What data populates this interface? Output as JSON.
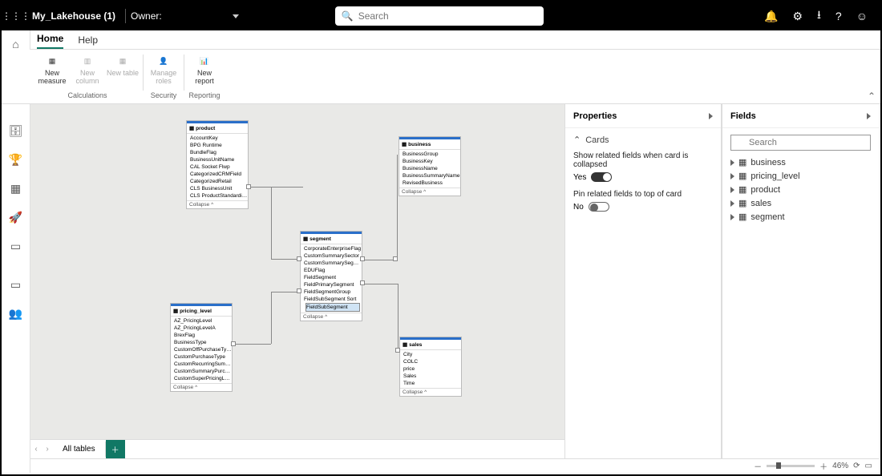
{
  "topbar": {
    "title": "My_Lakehouse (1)",
    "owner_label": "Owner:",
    "search_placeholder": "Search"
  },
  "tabs": {
    "home": "Home",
    "help": "Help"
  },
  "ribbon": {
    "new_measure": "New measure",
    "new_column": "New column",
    "new_table": "New table",
    "manage_roles": "Manage roles",
    "new_report": "New report",
    "group_calc": "Calculations",
    "group_sec": "Security",
    "group_rep": "Reporting"
  },
  "tables": {
    "product": {
      "name": "product",
      "fields": [
        "AccountKey",
        "BPG Runtime",
        "BundleFlag",
        "BusinessUnitName",
        "CAL Socket Flwp",
        "CategorizedCRMField",
        "CategorizedRetail",
        "CLS BusinessUnit",
        "CLS ProductStandardizedServices"
      ],
      "collapse": "Collapse ^"
    },
    "business": {
      "name": "business",
      "fields": [
        "BusinessGroup",
        "BusinessKey",
        "BusinessName",
        "BusinessSummaryName",
        "RevisedBusiness"
      ],
      "collapse": "Collapse ^"
    },
    "segment": {
      "name": "segment",
      "fields": [
        "CorporateEnterpriseFlag",
        "CustomSummarySector",
        "CustomSummarySegment",
        "EDUFlag",
        "FieldSegment",
        "FieldPrimarySegment",
        "FieldSegmentGroup",
        "FieldSubSegment Sort",
        "FieldSubSegment"
      ],
      "collapse": "Collapse ^"
    },
    "pricing_level": {
      "name": "pricing_level",
      "fields": [
        "AZ_PricingLevel",
        "AZ_PricingLevelA",
        "BrexFlag",
        "BusinessType",
        "CustomOffPurchaseType",
        "CustomPurchaseType",
        "CustomRecurringSummaryPurchaseTy",
        "CustomSummaryPurchaseType",
        "CustomSuperPricingLevel"
      ],
      "collapse": "Collapse ^"
    },
    "sales": {
      "name": "sales",
      "fields": [
        "City",
        "COLC",
        "price",
        "Sales",
        "Time"
      ],
      "collapse": "Collapse ^"
    }
  },
  "bottom_tab": {
    "all_tables": "All tables"
  },
  "properties": {
    "title": "Properties",
    "cards": "Cards",
    "show_related": "Show related fields when card is collapsed",
    "yes": "Yes",
    "pin_related": "Pin related fields to top of card",
    "no": "No"
  },
  "fields": {
    "title": "Fields",
    "search_placeholder": "Search",
    "items": [
      "business",
      "pricing_level",
      "product",
      "sales",
      "segment"
    ]
  },
  "status": {
    "zoom": "46%"
  }
}
